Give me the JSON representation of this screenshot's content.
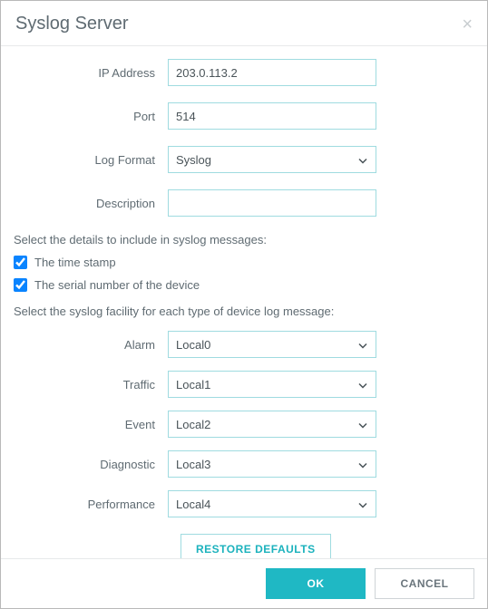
{
  "header": {
    "title": "Syslog Server"
  },
  "form": {
    "ip_address": {
      "label": "IP Address",
      "value": "203.0.113.2"
    },
    "port": {
      "label": "Port",
      "value": "514"
    },
    "log_format": {
      "label": "Log Format",
      "value": "Syslog"
    },
    "description": {
      "label": "Description",
      "value": ""
    }
  },
  "include_section": {
    "text": "Select the details to include in syslog messages:",
    "timestamp": {
      "label": "The time stamp",
      "checked": true
    },
    "serial": {
      "label": "The serial number of the device",
      "checked": true
    }
  },
  "facility_section": {
    "text": "Select the syslog facility for each type of device log message:",
    "rows": {
      "alarm": {
        "label": "Alarm",
        "value": "Local0"
      },
      "traffic": {
        "label": "Traffic",
        "value": "Local1"
      },
      "event": {
        "label": "Event",
        "value": "Local2"
      },
      "diagnostic": {
        "label": "Diagnostic",
        "value": "Local3"
      },
      "performance": {
        "label": "Performance",
        "value": "Local4"
      }
    }
  },
  "buttons": {
    "restore": "RESTORE DEFAULTS",
    "ok": "OK",
    "cancel": "CANCEL"
  }
}
